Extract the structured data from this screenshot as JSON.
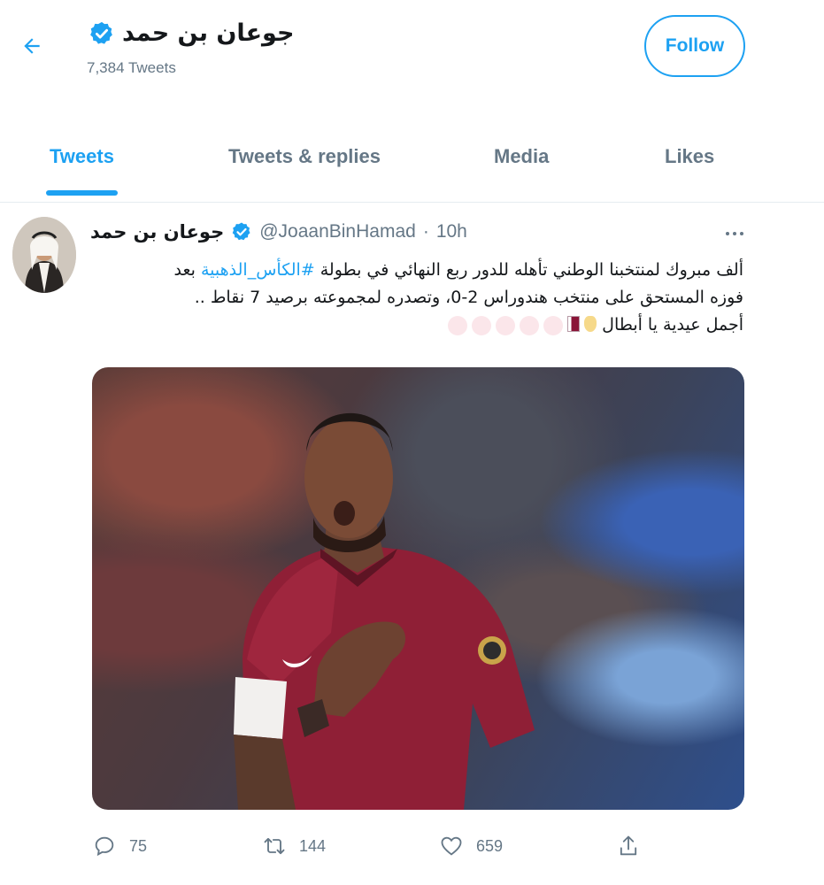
{
  "header": {
    "name": "جوعان بن حمد",
    "tweet_count": "7,384 Tweets",
    "follow_label": "Follow"
  },
  "tabs": [
    {
      "label": "Tweets",
      "active": true
    },
    {
      "label": "Tweets & replies",
      "active": false
    },
    {
      "label": "Media",
      "active": false
    },
    {
      "label": "Likes",
      "active": false
    }
  ],
  "tweet": {
    "author": "جوعان بن حمد",
    "handle": "@JoaanBinHamad",
    "separator": "·",
    "time": "10h",
    "text": {
      "line1_before": "ألف مبروك لمنتخبنا الوطني تأهله للدور ربع النهائي في بطولة ",
      "hashtag": "#الكأس_الذهبية",
      "line1_after": " بعد",
      "line2": "فوزه المستحق على منتخب هندوراس 2-0، وتصدره لمجموعته برصيد 7 نقاط ..",
      "line3": "أجمل عيدية يا أبطال"
    },
    "stats": {
      "replies": "75",
      "retweets": "144",
      "likes": "659"
    }
  },
  "colors": {
    "accent": "#1da1f2",
    "secondary_text": "#657786",
    "primary_text": "#14171a"
  },
  "icons": {
    "back": "arrow-left-icon",
    "verified": "verified-badge-icon",
    "more": "more-dots-icon",
    "reply": "reply-icon",
    "retweet": "retweet-icon",
    "like": "heart-icon",
    "share": "share-icon"
  }
}
